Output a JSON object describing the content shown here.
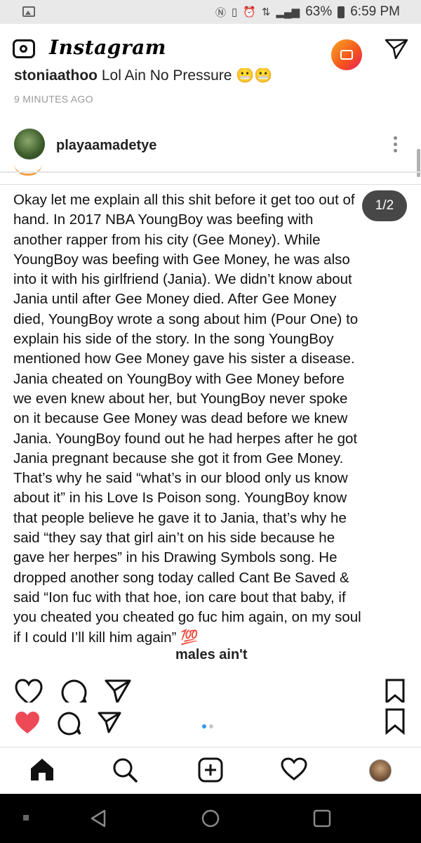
{
  "status_bar": {
    "icons": [
      "gallery-icon",
      "nfc-icon",
      "vibrate-icon",
      "alarm-icon",
      "4g-icon",
      "signal-icon",
      "battery-icon"
    ],
    "battery": "63%",
    "time": "6:59 PM"
  },
  "app_bar": {
    "title": "Instagram",
    "icons": [
      "camera-icon",
      "igtv-icon",
      "direct-message-icon"
    ]
  },
  "prev_comment": {
    "username": "stoniaathoo",
    "text": "Lol Ain No Pressure 😬😬",
    "timestamp": "9 MINUTES AGO"
  },
  "post": {
    "username": "playaamadetye",
    "carousel_counter": "1/2",
    "caption_lines": [
      "Okay let me explain all this shit before it get too out of",
      "hand. In 2017 NBA YoungBoy was beefing with",
      "another rapper from his city (Gee Money). While",
      "YoungBoy was beefing with Gee Money, he was also",
      "into it with his girlfriend (Jania). We didn’t know about",
      "Jania until after Gee Money died. After Gee Money",
      "died, YoungBoy wrote a song about him (Pour One) to",
      "explain his side of the story. In the song YoungBoy",
      "mentioned how Gee Money gave his sister a disease.",
      "Jania cheated on YoungBoy with Gee Money before",
      "we even knew about her, but YoungBoy never spoke",
      "on it because Gee Money was dead before we knew",
      "Jania. YoungBoy found out he had herpes after he got",
      "Jania pregnant because she got it from Gee Money.",
      "That’s why he said “what’s in our blood only us know",
      "about it” in his Love Is Poison song. YoungBoy know",
      "that people believe he gave it to Jania, that’s why he",
      "said “they say that girl ain’t on his side because he",
      "gave her herpes” in his Drawing Symbols song. He",
      "dropped another song today called Cant Be Saved &",
      "said “Ion fuc with that hoe, ion care bout that baby, if",
      "you cheated you cheated go fuc him again, on my soul",
      "if I could I’ll kill him again” 💯"
    ],
    "cut_off_text": "males ain't",
    "liked": true,
    "carousel_index": 1,
    "carousel_total": 2
  },
  "bottom_nav": {
    "items": [
      "home-icon",
      "search-icon",
      "new-post-icon",
      "activity-icon",
      "profile-avatar"
    ]
  },
  "android_nav": {
    "items": [
      "recent-apps-small",
      "back-icon",
      "home-circle-icon",
      "overview-icon"
    ]
  },
  "colors": {
    "like_red": "#ed4956",
    "carousel_active": "#3897f0",
    "carousel_inactive": "#c7c7c7"
  }
}
